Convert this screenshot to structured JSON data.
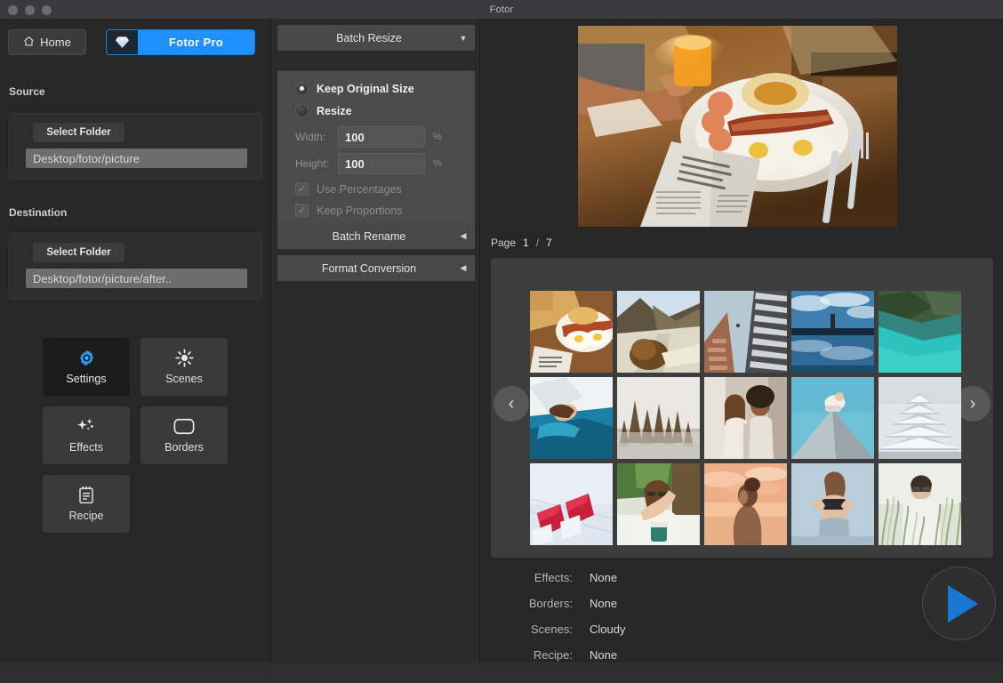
{
  "window": {
    "title": "Fotor",
    "controls": [
      "close-dot",
      "minimize-dot",
      "maximize-dot"
    ]
  },
  "sidebar": {
    "home_button": {
      "label": "Home",
      "icon": "home-icon"
    },
    "pro_button": {
      "label": "Fotor Pro",
      "icon": "diamond-icon",
      "accent": "#1e90ff"
    },
    "source": {
      "section_label": "Source",
      "select_folder_label": "Select Folder",
      "path_value": "Desktop/fotor/picture"
    },
    "destination": {
      "section_label": "Destination",
      "select_folder_label": "Select Folder",
      "path_value": "Desktop/fotor/picture/after.."
    },
    "tools": [
      {
        "label": "Settings",
        "icon": "gear-icon",
        "active": true
      },
      {
        "label": "Scenes",
        "icon": "sun-icon",
        "active": false
      },
      {
        "label": "Effects",
        "icon": "sparkle-icon",
        "active": false
      },
      {
        "label": "Borders",
        "icon": "frame-icon",
        "active": false
      },
      {
        "label": "Recipe",
        "icon": "clipboard-icon",
        "active": false
      }
    ]
  },
  "middle": {
    "batch_resize": {
      "header": "Batch Resize",
      "arrow": "chevron-down-icon",
      "options": [
        {
          "label": "Keep Original Size",
          "selected": true
        },
        {
          "label": "Resize",
          "selected": false
        }
      ],
      "width_label": "Width:",
      "width_value": "100",
      "height_label": "Height:",
      "height_value": "100",
      "unit": "%",
      "checkboxes": [
        {
          "label": "Use Percentages",
          "checked": true,
          "disabled": true
        },
        {
          "label": "Keep Proportions",
          "checked": true,
          "disabled": true
        }
      ]
    },
    "batch_rename": {
      "header": "Batch Rename",
      "arrow": "chevron-left-icon"
    },
    "format_conversion": {
      "header": "Format Conversion",
      "arrow": "chevron-left-icon"
    }
  },
  "right": {
    "page": {
      "label": "Page",
      "current": "1",
      "separator": "/",
      "total": "7"
    },
    "nav": {
      "prev": "chevron-left-icon",
      "next": "chevron-right-icon"
    },
    "preview_alt": "breakfast-plate-photo",
    "thumbnails": [
      "breakfast-plate",
      "mountain-road",
      "building-upward",
      "bridge-sea",
      "turquoise-lake",
      "person-blue-bed",
      "foggy-forest",
      "two-women",
      "figure-on-peak",
      "white-pyramid",
      "red-flags",
      "woman-glasses-drink",
      "woman-sunset",
      "woman-crop-top",
      "man-in-grass"
    ],
    "summary": [
      {
        "key": "Effects:",
        "value": "None"
      },
      {
        "key": "Borders:",
        "value": "None"
      },
      {
        "key": "Scenes:",
        "value": "Cloudy"
      },
      {
        "key": "Recipe:",
        "value": "None"
      }
    ],
    "play_button": {
      "icon": "play-icon",
      "accent": "#1877d2"
    }
  }
}
